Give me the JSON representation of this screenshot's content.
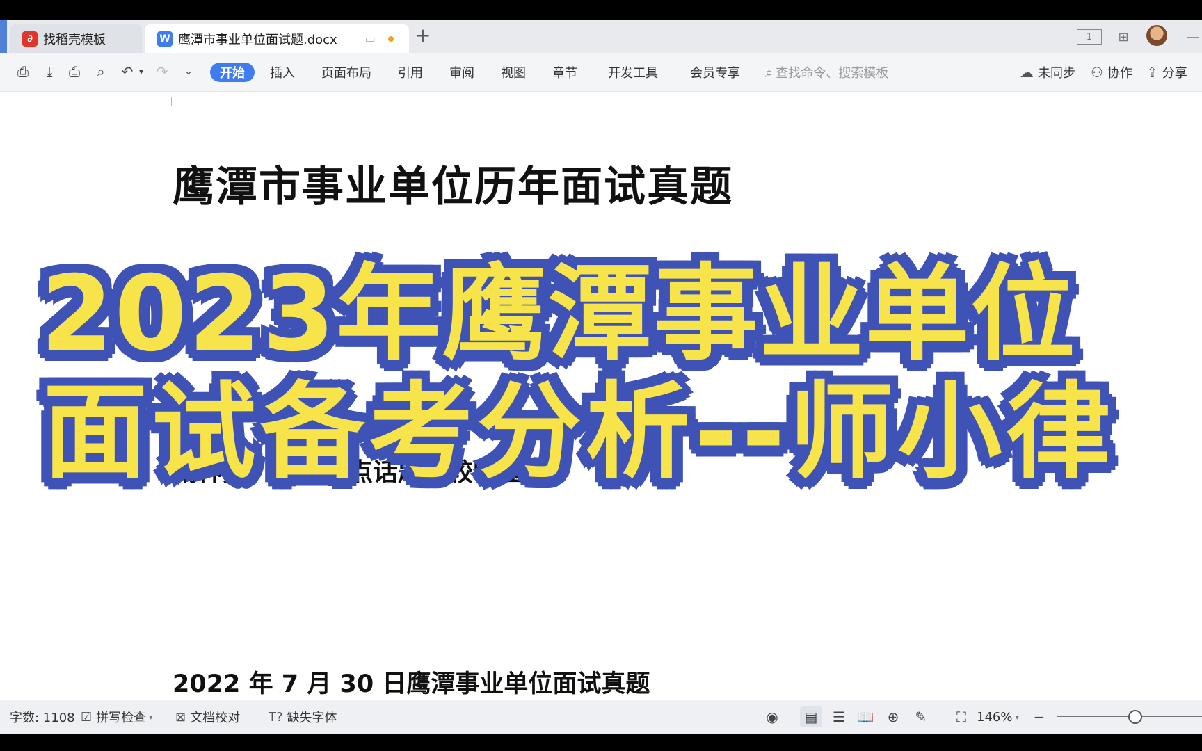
{
  "tabs": [
    {
      "label": "找稻壳模板",
      "icon": "docer-logo-icon"
    },
    {
      "label": "鹰潭市事业单位面试题.docx",
      "icon": "wps-writer-icon"
    }
  ],
  "toolbar": {
    "menus": [
      "开始",
      "插入",
      "页面布局",
      "引用",
      "审阅",
      "视图",
      "章节",
      "开发工具",
      "会员专享"
    ],
    "search_placeholder": "查找命令、搜索模板",
    "sync_label": "未同步",
    "collab_label": "协作",
    "share_label": "分享"
  },
  "document": {
    "title": "鹰潭市事业单位历年面试真题",
    "partial_line": "精神类、社会热点话题比较明显",
    "subheading": "2022 年 7 月 30 日鹰潭事业单位面试真题"
  },
  "overlay": {
    "line1": "2023年鹰潭事业单位",
    "line2": "面试备考分析--师小律",
    "fill_color": "#f7e34a",
    "stroke_color": "#3f52b5"
  },
  "status": {
    "word_count": "字数: 1108",
    "spellcheck": "拼写检查",
    "proofread": "文档校对",
    "missing_fonts": "缺失字体",
    "zoom": "146%"
  },
  "colors": {
    "accent": "#3f7cf1"
  }
}
